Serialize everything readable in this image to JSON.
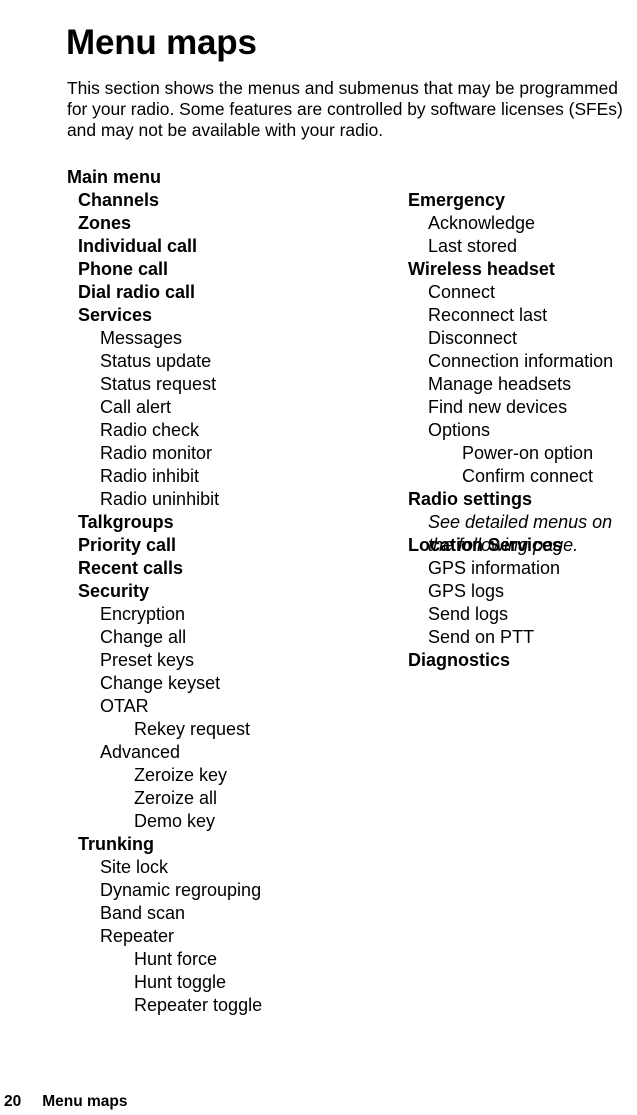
{
  "document": {
    "title": "Menu maps",
    "intro": "This section shows the menus and submenus that may be programmed for your radio. Some features are controlled by software licenses (SFEs) and may not be available with your radio."
  },
  "footer": {
    "page_number": "20",
    "section_title": "Menu maps"
  },
  "menu_map": {
    "left_column": [
      {
        "label": "Main menu",
        "level": 0
      },
      {
        "label": "Channels",
        "level": 1
      },
      {
        "label": "Zones",
        "level": 1
      },
      {
        "label": "Individual call",
        "level": 1
      },
      {
        "label": "Phone call",
        "level": 1
      },
      {
        "label": "Dial radio call",
        "level": 1
      },
      {
        "label": "Services",
        "level": 1
      },
      {
        "label": "Messages",
        "level": 2
      },
      {
        "label": "Status update",
        "level": 2
      },
      {
        "label": "Status request",
        "level": 2
      },
      {
        "label": "Call alert",
        "level": 2
      },
      {
        "label": "Radio check",
        "level": 2
      },
      {
        "label": "Radio monitor",
        "level": 2
      },
      {
        "label": "Radio inhibit",
        "level": 2
      },
      {
        "label": "Radio uninhibit",
        "level": 2
      },
      {
        "label": "Talkgroups",
        "level": 1
      },
      {
        "label": "Priority call",
        "level": 1
      },
      {
        "label": "Recent calls",
        "level": 1
      },
      {
        "label": "Security",
        "level": 1
      },
      {
        "label": "Encryption",
        "level": 2
      },
      {
        "label": "Change all",
        "level": 2
      },
      {
        "label": "Preset keys",
        "level": 2
      },
      {
        "label": "Change keyset",
        "level": 2
      },
      {
        "label": "OTAR",
        "level": 2
      },
      {
        "label": "Rekey request",
        "level": 3
      },
      {
        "label": "Advanced",
        "level": 2
      },
      {
        "label": "Zeroize key",
        "level": 3
      },
      {
        "label": "Zeroize all",
        "level": 3
      },
      {
        "label": "Demo key",
        "level": 3
      },
      {
        "label": "Trunking",
        "level": 1
      },
      {
        "label": "Site lock",
        "level": 2
      },
      {
        "label": "Dynamic regrouping",
        "level": 2
      },
      {
        "label": "Band scan",
        "level": 2
      },
      {
        "label": "Repeater",
        "level": 2
      },
      {
        "label": "Hunt force",
        "level": 3
      },
      {
        "label": "Hunt toggle",
        "level": 3
      },
      {
        "label": "Repeater toggle",
        "level": 3
      }
    ],
    "right_column": [
      {
        "label": "Emergency",
        "level": 1
      },
      {
        "label": "Acknowledge",
        "level": 2
      },
      {
        "label": "Last stored",
        "level": 2
      },
      {
        "label": "Wireless headset",
        "level": 1
      },
      {
        "label": "Connect",
        "level": 2
      },
      {
        "label": "Reconnect last",
        "level": 2
      },
      {
        "label": "Disconnect",
        "level": 2
      },
      {
        "label": "Connection information",
        "level": 2
      },
      {
        "label": "Manage headsets",
        "level": 2
      },
      {
        "label": "Find new devices",
        "level": 2
      },
      {
        "label": "Options",
        "level": 2
      },
      {
        "label": "Power-on option",
        "level": 3
      },
      {
        "label": "Confirm connect",
        "level": 3
      },
      {
        "label": "Radio settings",
        "level": 1
      },
      {
        "label": "See detailed menus on the following page.",
        "level": 2,
        "style": "note"
      },
      {
        "label": "Location Services",
        "level": 1
      },
      {
        "label": "GPS information",
        "level": 2
      },
      {
        "label": "GPS logs",
        "level": 2
      },
      {
        "label": "Send logs",
        "level": 2
      },
      {
        "label": "Send on PTT",
        "level": 2
      },
      {
        "label": "Diagnostics",
        "level": 1
      }
    ]
  }
}
